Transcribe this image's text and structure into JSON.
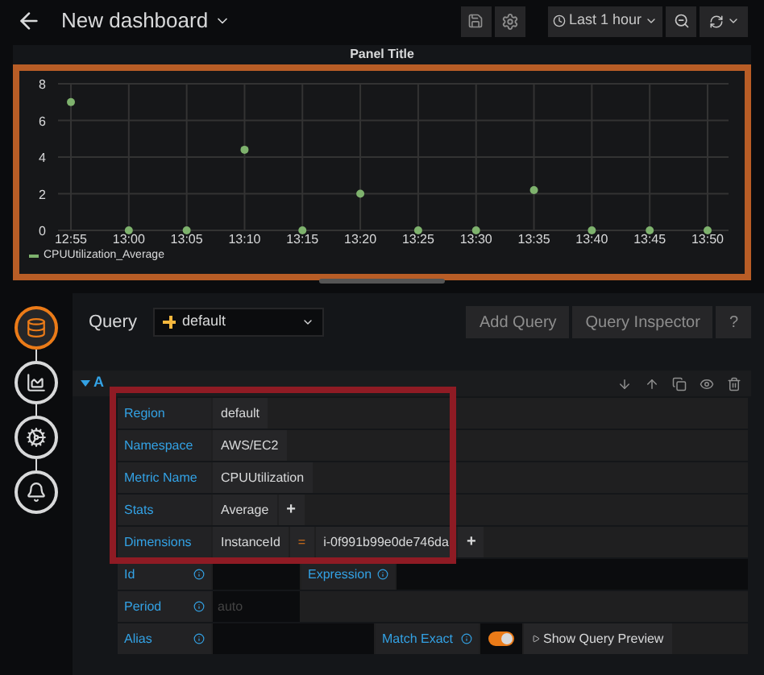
{
  "header": {
    "title": "New dashboard",
    "time_range": "Last 1 hour"
  },
  "panel": {
    "title": "Panel Title",
    "chart_data": {
      "type": "scatter",
      "grid": true,
      "categories": [
        "12:55",
        "13:00",
        "13:05",
        "13:10",
        "13:15",
        "13:20",
        "13:25",
        "13:30",
        "13:35",
        "13:40",
        "13:45",
        "13:50"
      ],
      "yticks": [
        0,
        2,
        4,
        6,
        8
      ],
      "ylim": [
        0,
        8
      ],
      "series": [
        {
          "name": "CPUUtilization_Average",
          "color": "#7eb26d",
          "values": [
            7,
            0,
            0,
            4.4,
            0,
            2,
            0,
            0,
            2.2,
            0,
            0,
            0
          ]
        }
      ]
    }
  },
  "rail": [
    {
      "kind": "database",
      "selected": true
    },
    {
      "kind": "chart",
      "selected": false
    },
    {
      "kind": "settings",
      "selected": false
    },
    {
      "kind": "alert",
      "selected": false
    }
  ],
  "query": {
    "label": "Query",
    "datasource": "default",
    "buttons": [
      "Add Query",
      "Query Inspector",
      "?"
    ]
  },
  "query_row": {
    "name": "A",
    "expanded": true
  },
  "fields": [
    {
      "label": "Region",
      "segments": [
        {
          "kind": "value",
          "text": "default"
        }
      ]
    },
    {
      "label": "Namespace",
      "segments": [
        {
          "kind": "value",
          "text": "AWS/EC2"
        }
      ]
    },
    {
      "label": "Metric Name",
      "segments": [
        {
          "kind": "value",
          "text": "CPUUtilization"
        }
      ]
    },
    {
      "label": "Stats",
      "segments": [
        {
          "kind": "value",
          "text": "Average"
        },
        {
          "kind": "add",
          "text": "+"
        }
      ]
    },
    {
      "label": "Dimensions",
      "segments": [
        {
          "kind": "value",
          "text": "InstanceId"
        },
        {
          "kind": "operator",
          "text": "="
        },
        {
          "kind": "value",
          "text": "i-0f991b99e0de746da"
        },
        {
          "kind": "add",
          "text": "+"
        }
      ]
    }
  ],
  "id_row": {
    "label": "Id",
    "expression_label": "Expression"
  },
  "period": {
    "label": "Period",
    "placeholder": "auto"
  },
  "alias": {
    "label": "Alias",
    "match_exact": {
      "label": "Match Exact",
      "on": true
    },
    "preview_button": "Show Query Preview"
  }
}
